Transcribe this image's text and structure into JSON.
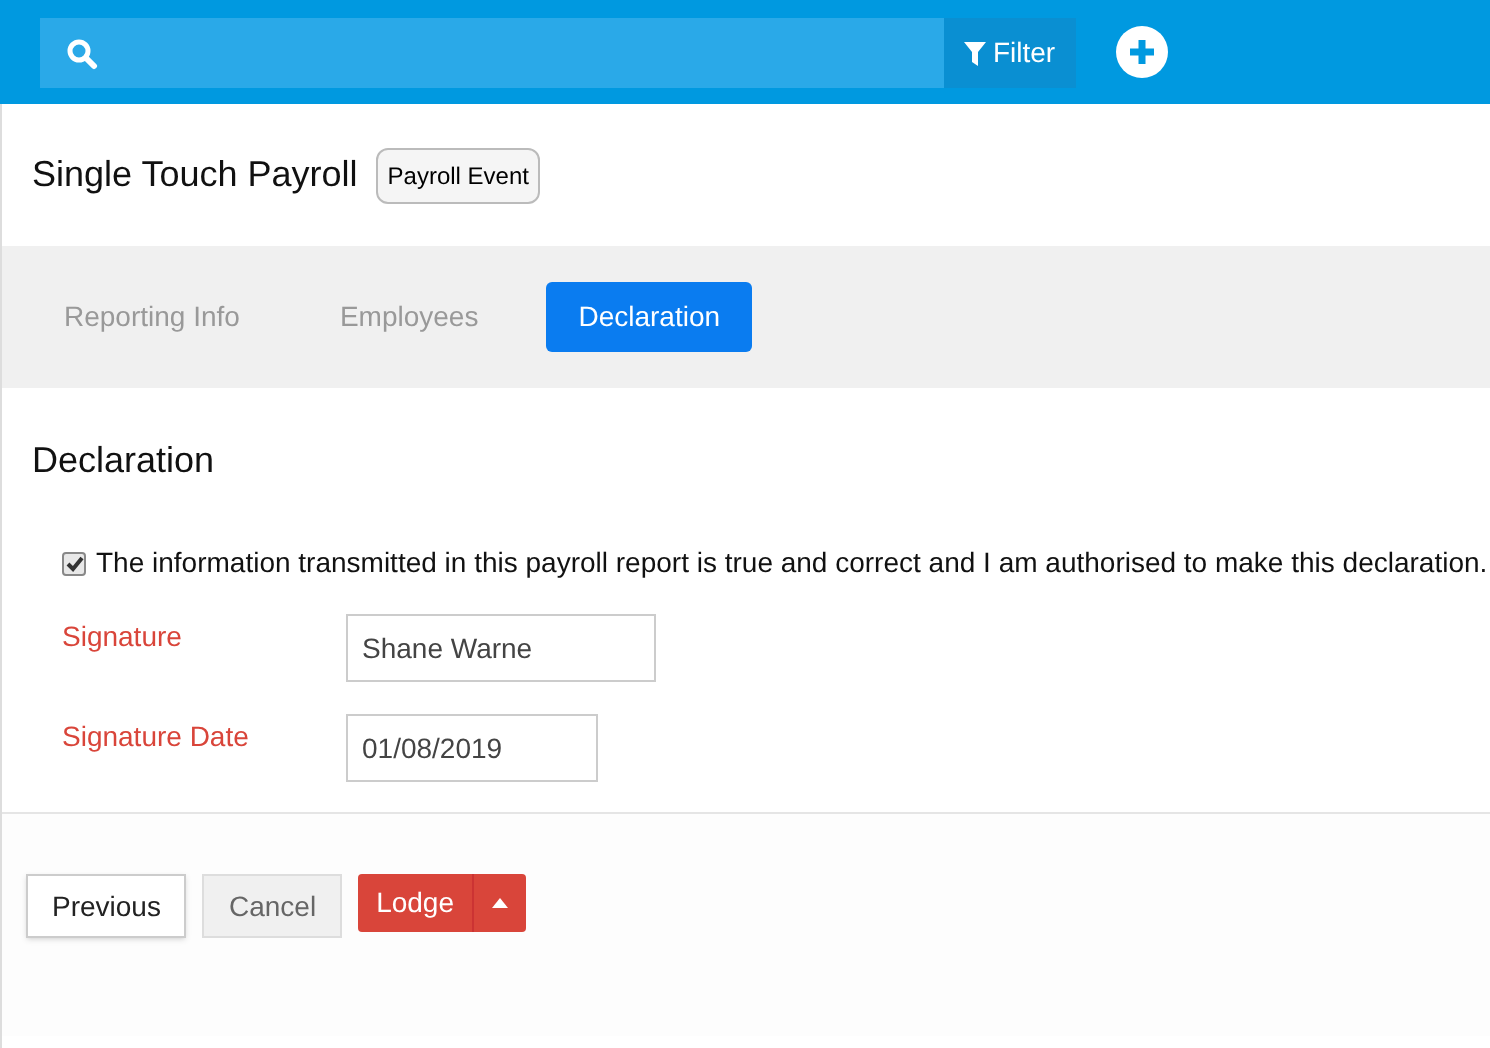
{
  "toolbar": {
    "filter_button": "Filter"
  },
  "header": {
    "title": "Single Touch Payroll",
    "badge": "Payroll Event"
  },
  "tabs": [
    {
      "label": "Reporting Info",
      "selected": false
    },
    {
      "label": "Employees",
      "selected": false
    },
    {
      "label": "Declaration",
      "selected": true
    }
  ],
  "section": {
    "heading": "Declaration",
    "declaration": {
      "checked": true,
      "text": "The information transmitted in this payroll report is true and correct and I am authorised to make this declaration."
    },
    "fields": [
      {
        "label": "Signature",
        "value": "Shane Warne"
      },
      {
        "label": "Signature Date",
        "value": "01/08/2019"
      }
    ]
  },
  "buttons": {
    "previous": "Previous",
    "cancel": "Cancel",
    "lodge": "Lodge"
  }
}
